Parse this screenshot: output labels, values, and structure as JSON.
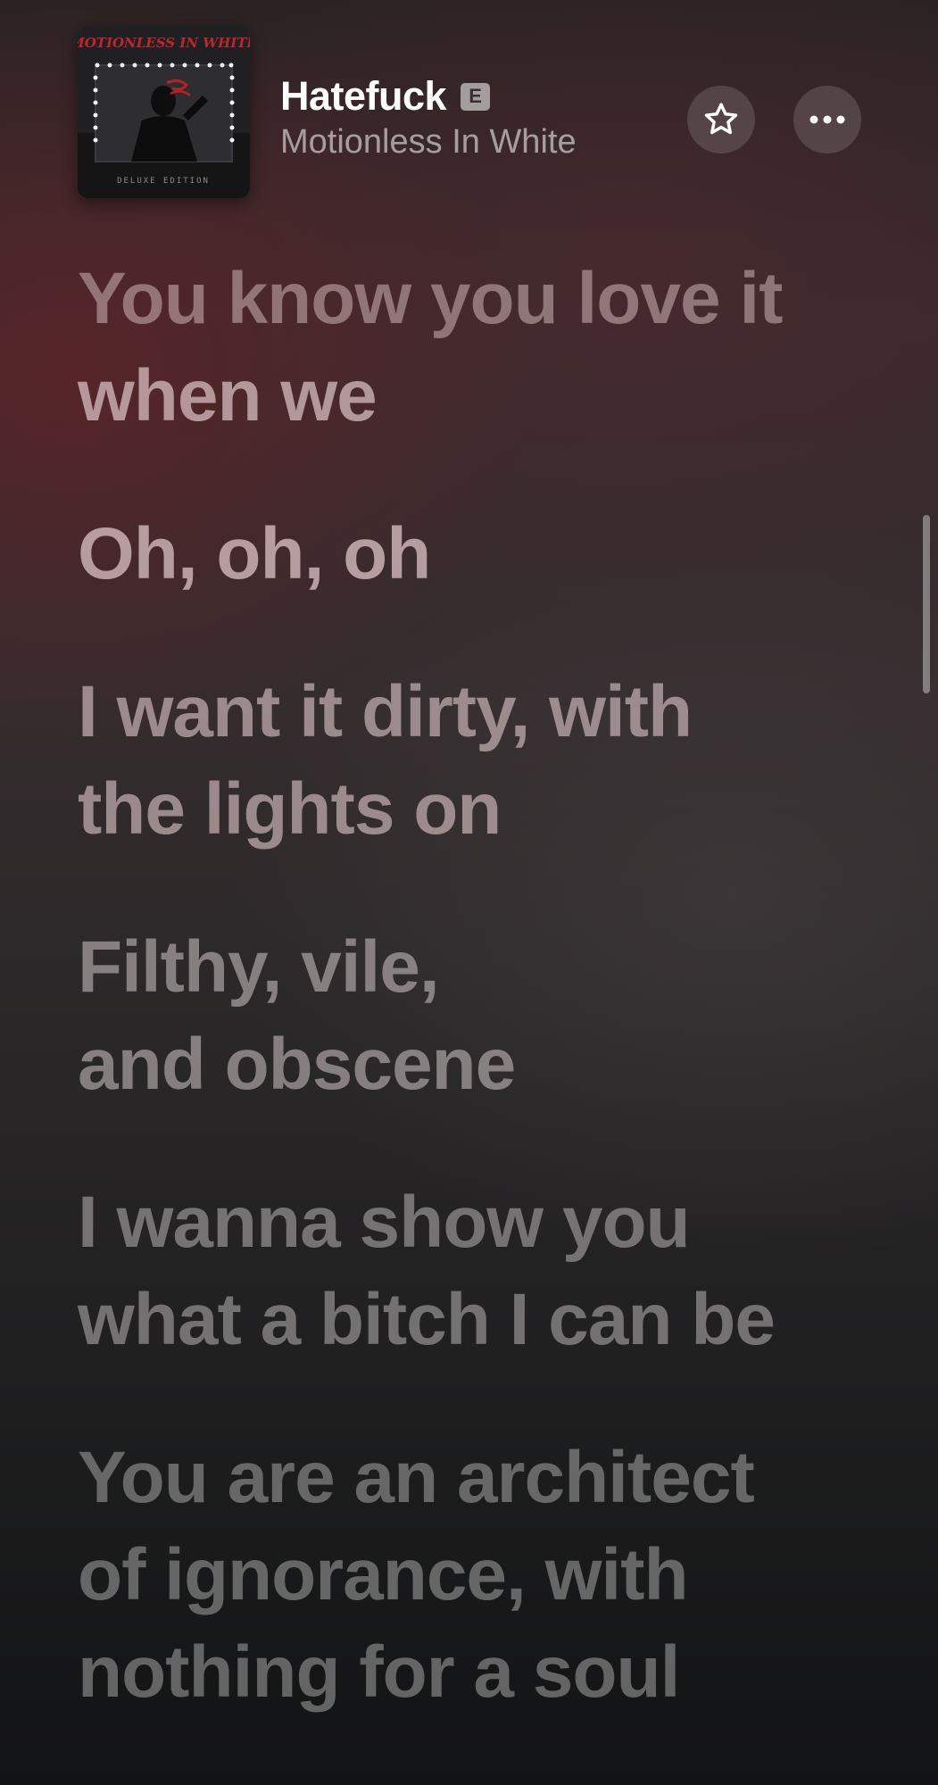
{
  "now_playing": {
    "title": "Hatefuck",
    "explicit_label": "E",
    "artist": "Motionless In White"
  },
  "album_art": {
    "band_text": "MOTIONLESS IN WHITE",
    "edition_text": "DELUXE EDITION"
  },
  "actions": {
    "favorite_icon": "star-outline-icon",
    "more_icon": "ellipsis-icon"
  },
  "lyrics": {
    "line1_part1": "You know you love it",
    "line1_part2": "when we",
    "line2": "Oh, oh, oh",
    "line3": "I want it dirty, with\nthe lights on",
    "line4": "Filthy, vile,\nand obscene",
    "line5": "I wanna show you\nwhat a bitch I can be",
    "line6": "You are an architect\nof ignorance, with\nnothing for a soul"
  },
  "colors": {
    "background_top": "#2b2224",
    "background_bottom": "#121314",
    "accent_red": "#5c2428"
  }
}
